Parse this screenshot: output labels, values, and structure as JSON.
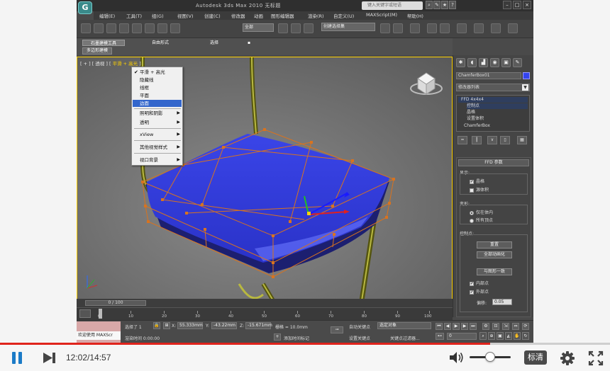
{
  "app": {
    "title": "Autodesk 3ds Max   2010    无标题",
    "search_placeholder": "键入关键字或短语",
    "logo": "G"
  },
  "menu": [
    "编辑(E)",
    "工具(T)",
    "组(G)",
    "视图(V)",
    "创建(C)",
    "修改器",
    "动画",
    "图形编辑器",
    "渲染(R)",
    "自定义(U)",
    "MAXScript(M)",
    "帮助(H)"
  ],
  "toolbar": {
    "selection_filter": "全部",
    "named_selection": "创建选择集"
  },
  "ribbon": {
    "tabs": [
      "石墨建模工具",
      "自由形式",
      "选择",
      "▪"
    ],
    "subtab": "多边形建模"
  },
  "viewport": {
    "label_parts": [
      "[ + ] [ 透视 ] [ ",
      "平滑 + 高光",
      " ]"
    ]
  },
  "context_menu": {
    "items": [
      {
        "label": "平滑 + 高光",
        "checked": true,
        "submenu": false,
        "selected": false
      },
      {
        "label": "隐藏线",
        "checked": false,
        "submenu": false,
        "selected": false
      },
      {
        "label": "线框",
        "checked": false,
        "submenu": false,
        "selected": false
      },
      {
        "label": "平面",
        "checked": false,
        "submenu": false,
        "selected": false
      },
      {
        "label": "边面",
        "checked": false,
        "submenu": false,
        "selected": true
      },
      {
        "label": "照明和阴影",
        "checked": false,
        "submenu": true,
        "selected": false
      },
      {
        "label": "透明",
        "checked": false,
        "submenu": true,
        "selected": false
      },
      {
        "label": "xView",
        "checked": false,
        "submenu": true,
        "selected": false
      },
      {
        "label": "其他视觉样式",
        "checked": false,
        "submenu": true,
        "selected": false
      },
      {
        "label": "视口背景",
        "checked": false,
        "submenu": true,
        "selected": false
      }
    ]
  },
  "command_panel": {
    "object_name": "ChamferBox01",
    "object_color": "#3344ee",
    "modifier_list": "修改器列表",
    "stack": [
      {
        "label": "FFD 4x4x4",
        "level": 0,
        "selected": true
      },
      {
        "label": "控制点",
        "level": 1,
        "selected": true
      },
      {
        "label": "晶格",
        "level": 1,
        "selected": false
      },
      {
        "label": "设置体积",
        "level": 1,
        "selected": false
      },
      {
        "label": "ChamferBox",
        "level": 0,
        "selected": false
      }
    ],
    "rollout_title": "FFD 参数",
    "display_group": "显示:",
    "display_options": [
      {
        "label": "晶格",
        "checked": true
      },
      {
        "label": "源体积",
        "checked": false
      }
    ],
    "deform_group": "变形:",
    "deform_options": [
      {
        "label": "仅在体内",
        "on": true
      },
      {
        "label": "所有顶点",
        "on": false
      }
    ],
    "control_group": "控制点:",
    "buttons": [
      "重置",
      "全部动画化",
      "与图形一致"
    ],
    "control_options": [
      {
        "label": "内部点",
        "checked": true
      },
      {
        "label": "外部点",
        "checked": true
      }
    ],
    "offset_label": "偏移:",
    "offset_value": "0.05"
  },
  "timeline": {
    "slider": "0 / 100",
    "ticks": [
      "0",
      "10",
      "20",
      "30",
      "40",
      "50",
      "60",
      "70",
      "80",
      "90",
      "100"
    ]
  },
  "status_bar": {
    "maxscript_label": "欢迎使用 MAXScr",
    "selected_text": "选择了 1",
    "render_time": "渲染时间 0:00:00",
    "x_value": "55.333mm",
    "y_value": "-43.22mm",
    "z_value": "-15.671mm",
    "grid_text": "栅格 = 10.0mm",
    "autokey": "自动关键点",
    "set_key": "设置关键点",
    "selected_obj": "选定对象",
    "key_filter": "关键点过滤器...",
    "add_time_tag": "添加时间标记",
    "frame": "0"
  },
  "player": {
    "current_time": "12:02",
    "total_time": "14:57",
    "time_display": "12:02/14:57",
    "progress": 0.804,
    "volume": 0.45,
    "quality_label": "标清",
    "accent_color": "#e0241c"
  }
}
